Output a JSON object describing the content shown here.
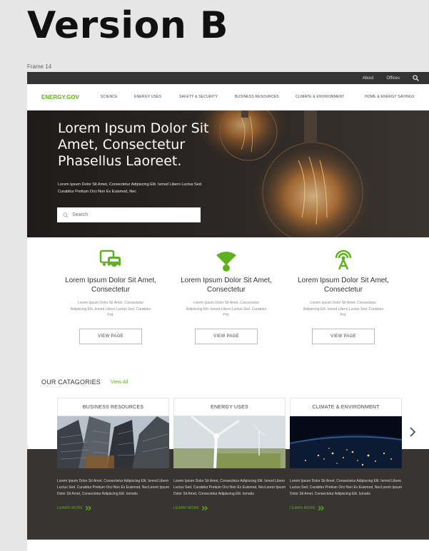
{
  "page_heading": "Version B",
  "frame_label": "Frame 14",
  "utility": {
    "about": "About",
    "offices": "Offices"
  },
  "nav": {
    "logo": "ENERGY.GOV",
    "items": [
      {
        "label": "SCIENCE"
      },
      {
        "label": "ENERGY USES"
      },
      {
        "label": "SAFETY & SECURITY"
      },
      {
        "label": "BUSINESS RESOURCES"
      },
      {
        "label": "CLIMATE & ENVIRONMENT"
      },
      {
        "label": "HOME & ENERGY SAVINGS"
      }
    ]
  },
  "hero": {
    "title": "Lorem Ipsum Dolor Sit Amet, Consectetur Phasellus Laoreet.",
    "subtitle": "Lorem Ipsum Dolor Sit Amet, Consectetur Adipiscing Elit. Ismod Libero Luctus Sed. Curabitur Pretium Orci Non Ex Euismod, Nec",
    "search_placeholder": "Search"
  },
  "features": [
    {
      "icon": "car-icon",
      "title": "Lorem Ipsum Dolor Sit Amet, Consectetur",
      "text": "Lorem Ipsum Dolor Sit Amet, Consectetur Adipiscing Elit. Ismod Libero Luctus Sed. Curabitur Prd.",
      "button": "VIEW PAGE"
    },
    {
      "icon": "wifi-icon",
      "title": "Lorem Ipsum Dolor Sit Amet, Consectetur",
      "text": "Lorem Ipsum Dolor Sit Amet, Consectetur Adipiscing Elit. Ismod Libero Luctus Sed. Curabitur Prd.",
      "button": "VIEW PAGE"
    },
    {
      "icon": "antenna-icon",
      "title": "Lorem Ipsum Dolor Sit Amet, Consectetur",
      "text": "Lorem Ipsum Dolor Sit Amet, Consectetur Adipiscing Elit. Ismod Libero Luctus Sed. Curabitur Prd.",
      "button": "VIEW PAGE"
    }
  ],
  "categories": {
    "title": "OUR CATAGORIES",
    "view_all": "View All",
    "cards": [
      {
        "title": "BUSINESS RESOURCES",
        "text": "Lorem Ipsum Dolor Sit Amet, Consectetur Adipiscing Elit. Ismod Libero Luctus Sed. Curabitur Pretium Orci Non Ex Euismod, NecLorem Ipsum Dolor Sit Amet, Consectetur Adipiscing Elit. Ismods",
        "link": "LEARN MORE"
      },
      {
        "title": "ENERGY USES",
        "text": "Lorem Ipsum Dolor Sit Amet, Consectetur Adipiscing Elit. Ismod Libero Luctus Sed. Curabitur Pretium Orci Non Ex Euismod, NecLorem Ipsum Dolor Sit Amet, Consectetur Adipiscing Elit. Ismods",
        "link": "LEARN MORE"
      },
      {
        "title": "CLIMATE & ENVIRONMENT",
        "text": "Lorem Ipsum Dolor Sit Amet, Consectetur Adipiscing Elit. Ismod Libero Luctus Sed. Curabitur Pretium Orci Non Ex Euismod, NecLorem Ipsum Dolor Sit Amet, Consectetur Adipiscing Elit. Ismods",
        "link": "LEARN MORE"
      }
    ]
  },
  "colors": {
    "accent": "#5fb21f",
    "dark": "#373431",
    "topbar": "#333333"
  }
}
